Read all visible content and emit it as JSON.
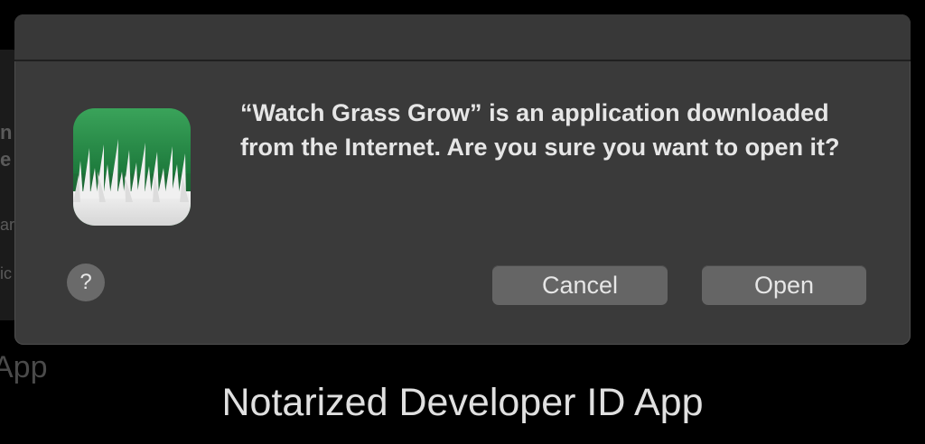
{
  "background": {
    "fragments": [
      "n",
      "e",
      "ar",
      "ic"
    ],
    "partial_label": "App"
  },
  "dialog": {
    "app_icon": "grass-app-icon",
    "message": "“Watch Grass Grow” is an application downloaded from the Internet. Are you sure you want to open it?",
    "help_label": "?",
    "cancel_label": "Cancel",
    "open_label": "Open"
  },
  "caption": "Notarized Developer ID App",
  "colors": {
    "page_background": "#000000",
    "dialog_background": "#3a3a3a",
    "button_background": "#656565",
    "text": "#e6e6e6"
  }
}
